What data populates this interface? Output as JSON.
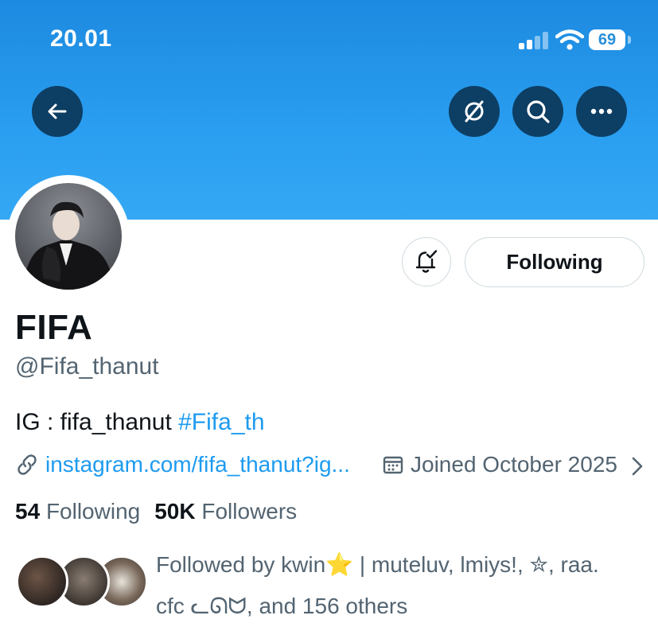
{
  "status_bar": {
    "time": "20.01",
    "battery": "69"
  },
  "header": {
    "back_icon": "arrow-left-icon",
    "grok_icon": "slash-circle-icon",
    "search_icon": "search-icon",
    "more_icon": "more-horizontal-icon"
  },
  "profile": {
    "display_name": "FIFA",
    "handle": "@Fifa_thanut",
    "bio_text": "IG : fifa_thanut ",
    "bio_hashtag": "#Fifa_th",
    "website": "instagram.com/fifa_thanut?ig...",
    "joined": "Joined October 2025",
    "following_count": "54",
    "following_label": "Following",
    "followers_count": "50K",
    "followers_label": "Followers",
    "followed_by": "Followed by kwin⭐️ | muteluv, lmiys!, ✮, raa. cfc ᓚᘏᗢ, and 156 others"
  },
  "actions": {
    "notify_icon": "bell-check-icon",
    "following_button": "Following"
  },
  "colors": {
    "banner": "#2a9ef0",
    "header_button": "#0d3e63",
    "link": "#1d9bf0",
    "secondary_text": "#536471"
  }
}
